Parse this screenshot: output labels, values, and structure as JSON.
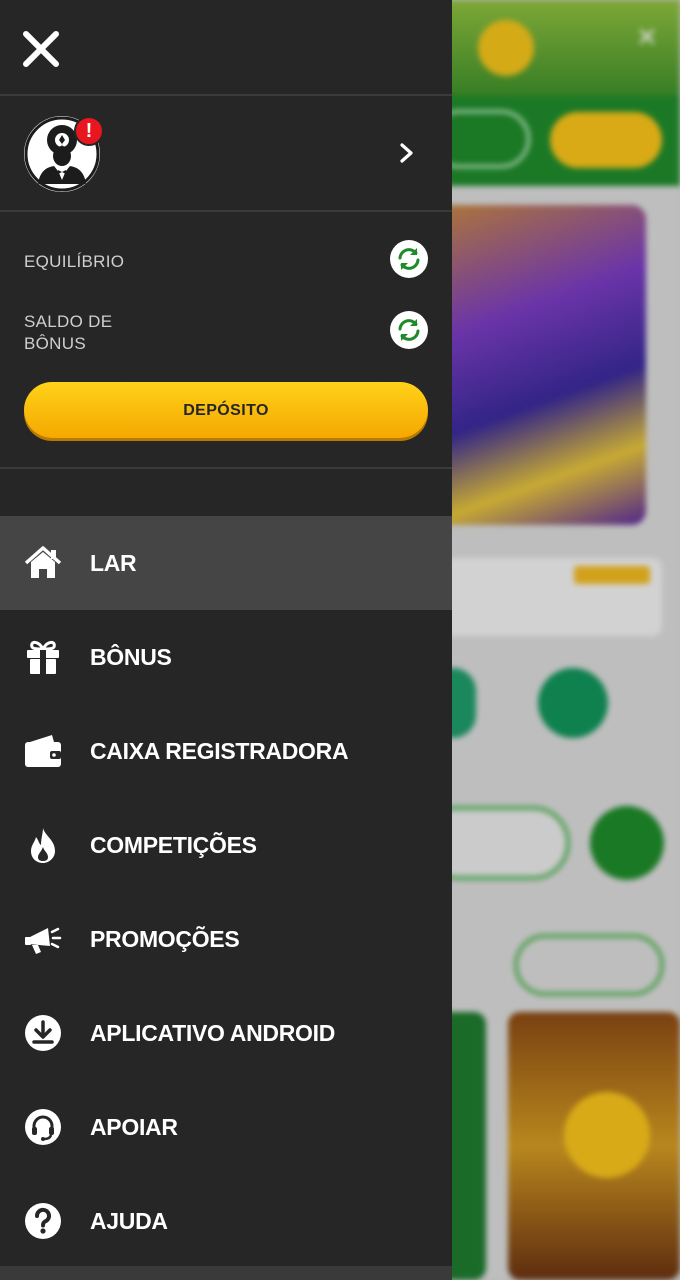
{
  "drawer": {
    "close_icon": "close-icon",
    "profile": {
      "avatar_icon": "poker-dealer-avatar",
      "alert_badge": "!",
      "chevron_icon": "chevron-right-icon"
    },
    "balance_label": "EQUILÍBRIO",
    "bonus_balance_label_line1": "SALDO DE",
    "bonus_balance_label_line2": "BÔNUS",
    "deposit_label": "DEPÓSITO",
    "menu": [
      {
        "label": "LAR",
        "icon": "home-icon",
        "active": true
      },
      {
        "label": "BÔNUS",
        "icon": "gift-icon"
      },
      {
        "label": "CAIXA REGISTRADORA",
        "icon": "wallet-icon"
      },
      {
        "label": "COMPETIÇÕES",
        "icon": "fire-icon"
      },
      {
        "label": "PROMOÇÕES",
        "icon": "megaphone-icon"
      },
      {
        "label": "APLICATIVO ANDROID",
        "icon": "download-icon"
      },
      {
        "label": "APOIAR",
        "icon": "headset-icon"
      },
      {
        "label": "AJUDA",
        "icon": "help-icon"
      }
    ]
  },
  "colors": {
    "drawer_bg": "#262626",
    "active_item_bg": "#454545",
    "deposit_yellow": "#ffd21a",
    "refresh_green": "#1e8a2a",
    "alert_red": "#e8161f"
  }
}
